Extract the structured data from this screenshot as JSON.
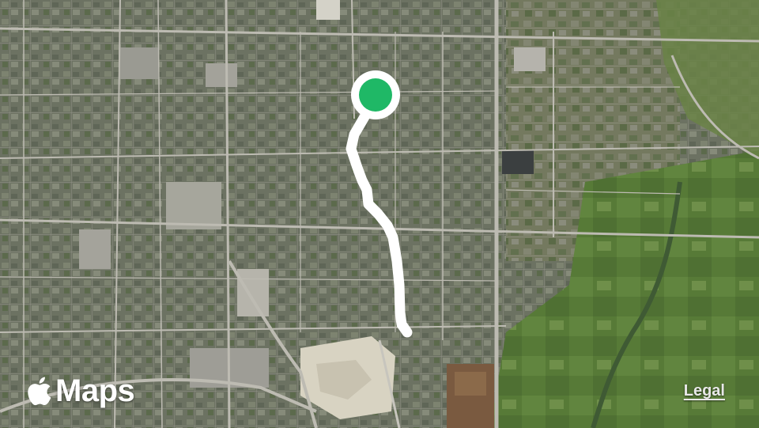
{
  "map": {
    "type": "satellite",
    "brand": {
      "name": "Maps",
      "icon": "apple-logo-icon"
    },
    "legal_link": "Legal",
    "route": {
      "color": "#ffffff",
      "start_marker": {
        "icon": "location-start-icon",
        "color": "#1fb866"
      }
    },
    "colors": {
      "urban": "#6d7366",
      "suburb": "#7a8064",
      "farmland": "#587a3a",
      "road": "#b9b7ad",
      "quarry": "#d9d4c4"
    }
  }
}
